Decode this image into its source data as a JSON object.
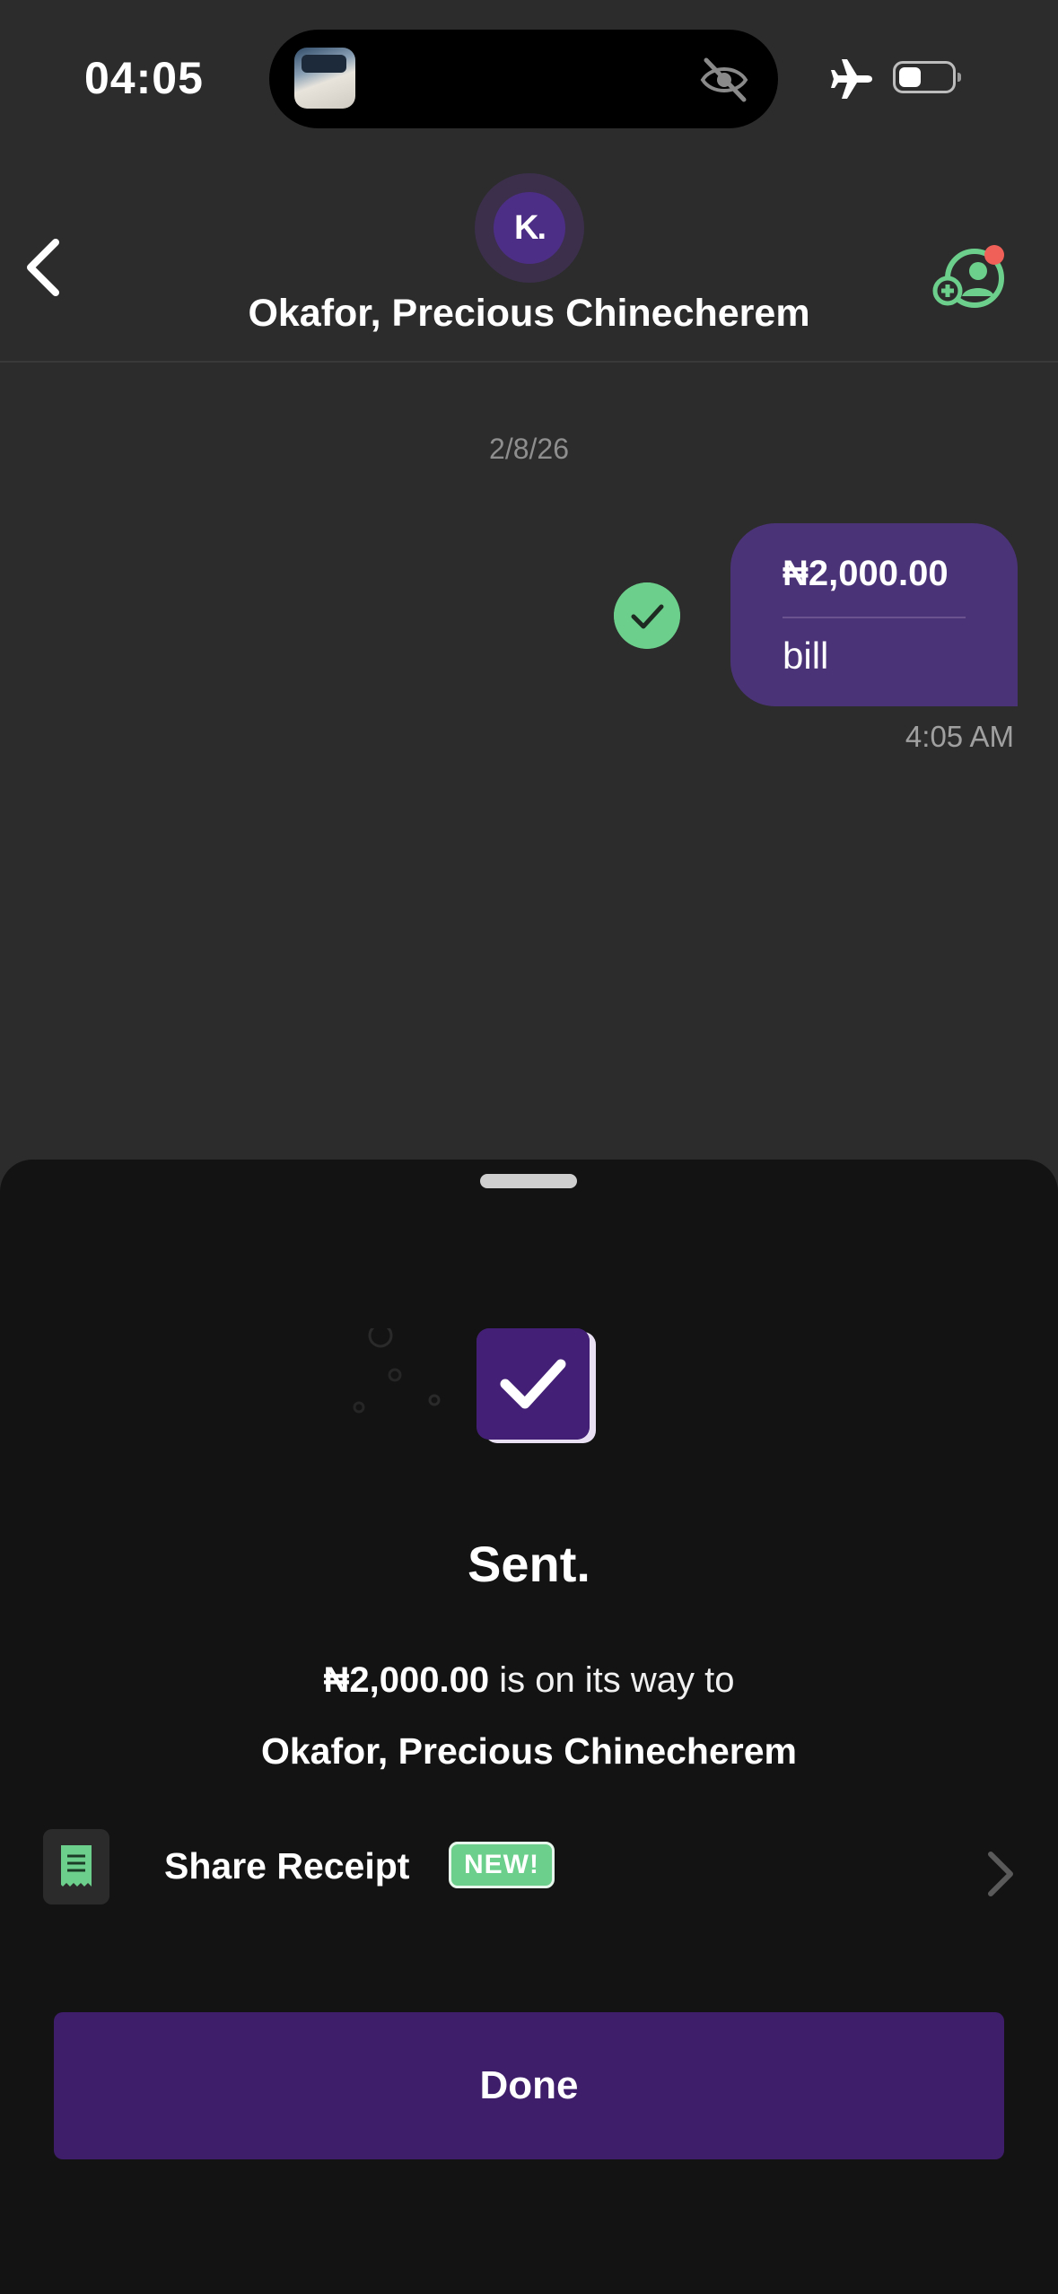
{
  "status_bar": {
    "time": "04:05",
    "icons": [
      "app-thumbnail",
      "eye-slash-icon",
      "airplane-icon",
      "battery-icon"
    ]
  },
  "header": {
    "avatar_initials": "K.",
    "contact_name": "Okafor, Precious Chinecherem",
    "icons": [
      "chevron-left-icon",
      "add-contact-icon"
    ]
  },
  "chat": {
    "date": "2/8/26",
    "message": {
      "amount": "₦2,000.00",
      "note": "bill",
      "time": "4:05 AM",
      "status": "delivered"
    }
  },
  "sheet": {
    "title": "Sent.",
    "amount": "₦2,000.00",
    "line_text": " is on its way to",
    "recipient": "Okafor, Precious Chinecherem",
    "share_label": "Share Receipt",
    "new_badge": "NEW!",
    "done_label": "Done"
  },
  "colors": {
    "background": "#2c2c2c",
    "sheet": "#131313",
    "accent_purple": "#4b3378",
    "button_purple": "#3e1d6a",
    "success_green": "#6ccf8b"
  }
}
